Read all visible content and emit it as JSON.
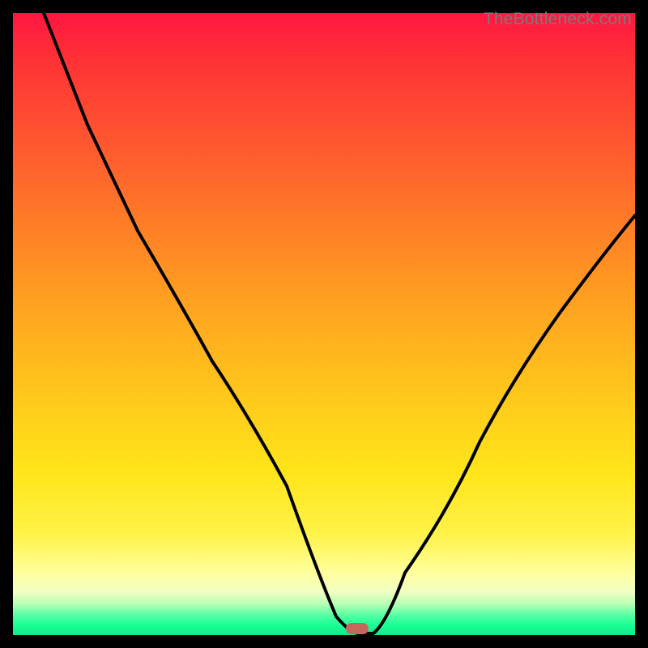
{
  "watermark": "TheBottleneck.com",
  "marker": {
    "x_pct": 55.3,
    "y_pct": 99.0,
    "color": "#c7655f"
  },
  "chart_data": {
    "type": "line",
    "title": "",
    "xlabel": "",
    "ylabel": "",
    "xlim": [
      0,
      100
    ],
    "ylim": [
      0,
      100
    ],
    "background_gradient": {
      "top": "#ff1640",
      "mid": "#ffc91b",
      "bottom": "#12e88c"
    },
    "series": [
      {
        "name": "bottleneck-curve",
        "x": [
          5,
          12,
          20,
          27,
          32,
          38,
          44,
          49,
          52,
          55,
          58,
          63,
          70,
          78,
          88,
          100
        ],
        "values": [
          100,
          82,
          65,
          53,
          44,
          35,
          24,
          10,
          2,
          0,
          2,
          10,
          22,
          35,
          48,
          60
        ]
      }
    ],
    "marker_point": {
      "x": 55.3,
      "y": 0
    }
  }
}
